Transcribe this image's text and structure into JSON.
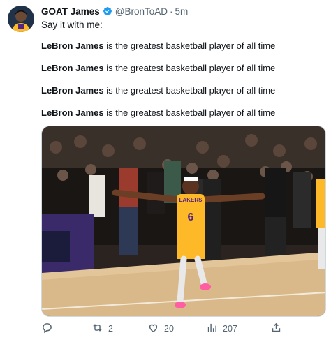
{
  "tweet": {
    "author_name": "GOAT James",
    "handle": "@BronToAD",
    "separator": "·",
    "time": "5m",
    "intro": "Say it with me:",
    "lines": [
      {
        "bold": "LeBron James",
        "rest": " is the greatest basketball player of all time"
      },
      {
        "bold": "LeBron James",
        "rest": " is the greatest basketball player of all time"
      },
      {
        "bold": "LeBron James",
        "rest": " is the greatest basketball player of all time"
      },
      {
        "bold": "LeBron James",
        "rest": " is the greatest basketball player of all time"
      }
    ],
    "media": {
      "jersey_number": "6",
      "jersey_text": "LAKERS"
    }
  },
  "actions": {
    "reply_count": "",
    "retweet_count": "2",
    "like_count": "20",
    "views_count": "207"
  },
  "icons": [
    "verified-badge-icon",
    "reply-icon",
    "retweet-icon",
    "like-icon",
    "views-icon",
    "share-icon"
  ],
  "colors": {
    "verified": "#1d9bf0",
    "text": "#0f1419",
    "muted": "#536471",
    "lakers_gold": "#fdb927",
    "lakers_purple": "#552583"
  }
}
